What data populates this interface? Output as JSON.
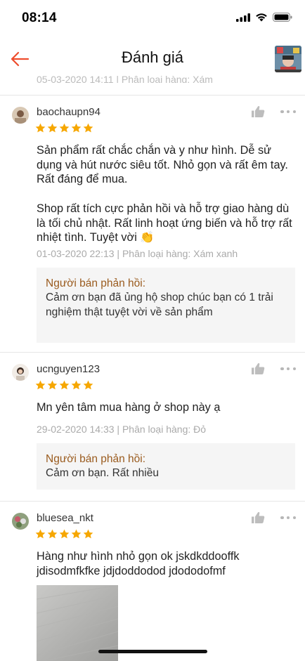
{
  "status": {
    "time": "08:14"
  },
  "nav": {
    "title": "Đánh giá"
  },
  "peek": {
    "text": "05-03-2020 14:11 | Phân loại hàng: Xám"
  },
  "reviews": [
    {
      "username": "baochaupn94",
      "rating": 5,
      "paragraphs": [
        "Sản phẩm rất chắc chắn và y như hình. Dễ sử dụng và hút nước siêu tốt. Nhỏ gọn và rất êm tay. Rất đáng để mua.",
        "Shop rất tích cực phản hồi và hỗ trợ giao hàng dù là tối chủ nhật. Rất linh hoạt ứng biến và hỗ trợ rất nhiệt tình. Tuyệt vời 👏"
      ],
      "meta": "01-03-2020 22:13 | Phân loại hàng: Xám xanh",
      "reply_label": "Người bán phản hồi:",
      "reply_text": "Cảm ơn bạn đã ủng hộ shop chúc bạn có 1 trải nghiệm thật tuyệt vời về sản phẩm"
    },
    {
      "username": "ucnguyen123",
      "rating": 5,
      "paragraphs": [
        "Mn yên tâm mua hàng ở shop này ạ"
      ],
      "meta": "29-02-2020 14:33 | Phân loại hàng: Đỏ",
      "reply_label": "Người bán phản hồi:",
      "reply_text": "Cảm ơn bạn.  Rất nhiều"
    },
    {
      "username": "bluesea_nkt",
      "rating": 5,
      "paragraphs": [
        "Hàng như hình nhỏ gọn ok jskdkddooffk jdisodmfkfke jdjdoddodod jdododofmf"
      ]
    }
  ],
  "colors": {
    "accent": "#ee4d2d",
    "star": "#f6a700",
    "reply_label": "#9a5b1e"
  }
}
